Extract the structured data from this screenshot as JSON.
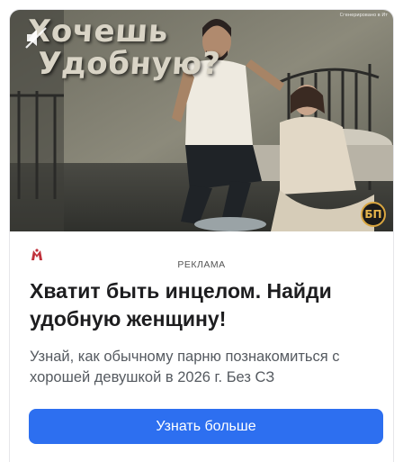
{
  "ad": {
    "media": {
      "caption_line1": "Хочешь",
      "caption_line2": "Удобную?",
      "source_label": "Сгенерировано в Ит",
      "badge": "БП",
      "mute_icon": "speaker-muted-icon"
    },
    "brand_icon": "brand-logo-icon",
    "label": "РЕКЛАМА",
    "headline": "Хватит быть инцелом. Найди удобную женщину!",
    "description": "Узнай, как обычному парню познакомиться с хорошей девушкой в 2026 г. Без СЗ",
    "cta_label": "Узнать больше",
    "colors": {
      "cta": "#2d6ff0",
      "brand_icon": "#c0303a",
      "badge_ring": "#d9a640"
    }
  }
}
